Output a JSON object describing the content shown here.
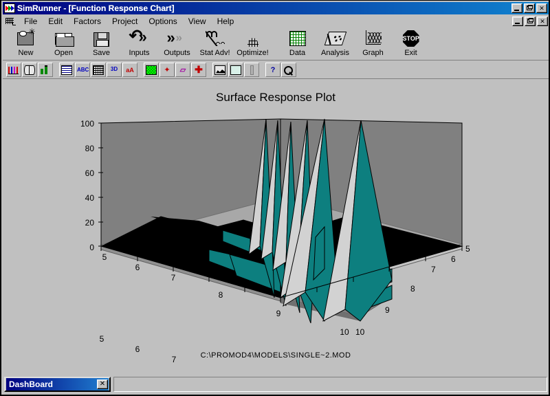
{
  "window": {
    "title": "SimRunner - [Function Response Chart]",
    "app_icon": "simrunner-icon",
    "minimize_label": "_",
    "maximize_label": "❐",
    "close_label": "✕"
  },
  "menu": {
    "mdi_icon": "document-control-icon",
    "items": [
      {
        "label": "File",
        "accel": "F"
      },
      {
        "label": "Edit",
        "accel": "E"
      },
      {
        "label": "Factors",
        "accel": "a"
      },
      {
        "label": "Project",
        "accel": "P"
      },
      {
        "label": "Options",
        "accel": "O"
      },
      {
        "label": "View",
        "accel": "V"
      },
      {
        "label": "Help",
        "accel": "H"
      }
    ]
  },
  "toolbar_main": {
    "buttons": [
      {
        "label": "New",
        "icon": "new-document-icon"
      },
      {
        "label": "Open",
        "icon": "open-folder-icon"
      },
      {
        "label": "Save",
        "icon": "floppy-disk-icon"
      },
      {
        "label": "Inputs",
        "icon": "inputs-arrow-icon"
      },
      {
        "label": "Outputs",
        "icon": "outputs-arrow-icon"
      },
      {
        "label": "Stat Adv!",
        "icon": "stat-advisor-icon"
      },
      {
        "label": "Optimize!",
        "icon": "optimize-mesh-icon"
      },
      {
        "label": "Data",
        "icon": "data-grid-icon"
      },
      {
        "label": "Analysis",
        "icon": "analysis-scatter-icon"
      },
      {
        "label": "Graph",
        "icon": "graph-3d-icon"
      },
      {
        "label": "Exit",
        "icon": "stop-sign-icon",
        "icon_text": "STOP"
      }
    ]
  },
  "toolbar_secondary": {
    "buttons": [
      {
        "icon": "bar-chart-icon",
        "group": 1
      },
      {
        "icon": "cylinder-chart-icon",
        "group": 1
      },
      {
        "icon": "stacked-bar-icon",
        "group": 1
      },
      {
        "icon": "table-view-icon",
        "group": 2
      },
      {
        "icon": "abc-text-icon",
        "group": 2,
        "text": "ABC"
      },
      {
        "icon": "grid-lines-icon",
        "group": 2
      },
      {
        "icon": "three-d-icon",
        "group": 2,
        "text": "3D"
      },
      {
        "icon": "font-color-icon",
        "group": 2,
        "text": "aA"
      },
      {
        "icon": "pattern-fill-icon",
        "group": 3
      },
      {
        "icon": "sparkle-points-icon",
        "group": 3
      },
      {
        "icon": "function-curve-icon",
        "group": 3
      },
      {
        "icon": "crosshair-icon",
        "group": 3
      },
      {
        "icon": "area-chart-icon",
        "group": 4
      },
      {
        "icon": "print-icon",
        "group": 4
      },
      {
        "icon": "pen-icon",
        "group": 4
      },
      {
        "icon": "help-question-icon",
        "group": 5,
        "text": "?"
      },
      {
        "icon": "magnifier-icon",
        "group": 5
      }
    ]
  },
  "chart": {
    "title": "Surface Response Plot",
    "footer_path": "C:\\PROMOD4\\MODELS\\SINGLE~2.MOD"
  },
  "chart_data": {
    "type": "surface",
    "title": "Surface Response Plot",
    "zlabel": "",
    "xlabel": "",
    "ylabel": "",
    "z_ticks": [
      0,
      20,
      40,
      60,
      80,
      100
    ],
    "zlim": [
      0,
      100
    ],
    "x_ticks": [
      5,
      6,
      7,
      8,
      9,
      10
    ],
    "y_ticks": [
      5,
      6,
      7,
      8,
      9,
      10
    ],
    "xlim": [
      5,
      10
    ],
    "ylim": [
      5,
      10
    ],
    "grid": false,
    "legend": "none",
    "surface_colors": {
      "high_face_light": "#d2d2d2",
      "high_face_teal": "#0d7f7f",
      "back_wall": "#808080",
      "floor_low": "#000000",
      "floor_plateau": "#808080",
      "plot_background": "#c0c0c0"
    },
    "description": "Ridged response surface: value is near 0 across the low-x / low-y corner (black floor region) and rises to the 100 maximum in a series of sharp knife-edge ridges concentrated toward the x=9..10 and y=8..10 corner.",
    "z_matrix": [
      [
        0,
        0,
        0,
        0,
        0,
        0
      ],
      [
        0,
        0,
        0,
        0,
        0,
        0
      ],
      [
        0,
        0,
        0,
        0,
        100,
        0
      ],
      [
        0,
        0,
        0,
        100,
        0,
        100
      ],
      [
        0,
        0,
        100,
        0,
        100,
        0
      ],
      [
        0,
        100,
        0,
        100,
        0,
        100
      ]
    ],
    "ridge_peaks_z": [
      100,
      100,
      100,
      100,
      100,
      100,
      100
    ]
  },
  "status": {
    "dashboard_title": "DashBoard",
    "dashboard_close": "✕"
  }
}
